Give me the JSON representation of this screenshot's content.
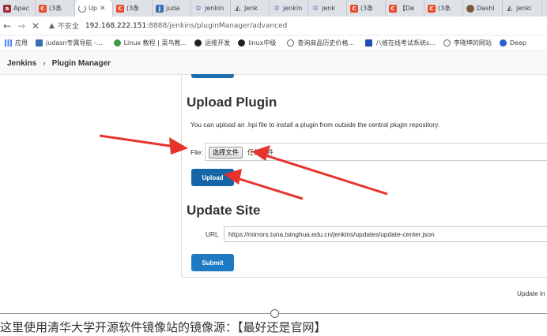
{
  "browser": {
    "tabs": [
      {
        "icon": "apache-icon",
        "label": "Apac",
        "active": false
      },
      {
        "icon": "csdn-icon",
        "label": "(3条",
        "active": false
      },
      {
        "icon": "loading-icon",
        "label": "Up",
        "active": true,
        "close": "✕"
      },
      {
        "icon": "csdn-icon",
        "label": "(3条",
        "active": false
      },
      {
        "icon": "judas-icon",
        "label": "juda",
        "active": false
      },
      {
        "icon": "jenkins-icon",
        "label": "jenkin",
        "active": false
      },
      {
        "icon": "jenkins-icon",
        "label": "Jenk",
        "active": false
      },
      {
        "icon": "jenkins-icon",
        "label": "jenkin",
        "active": false
      },
      {
        "icon": "jenkins-icon",
        "label": "jenk",
        "active": false
      },
      {
        "icon": "csdn-icon",
        "label": "(3条",
        "active": false
      },
      {
        "icon": "csdn-icon",
        "label": "【De",
        "active": false
      },
      {
        "icon": "csdn-icon",
        "label": "(3条",
        "active": false
      },
      {
        "icon": "dashboard-icon",
        "label": "Dashl",
        "active": false
      },
      {
        "icon": "jenkins-icon",
        "label": "jenki",
        "active": false
      }
    ],
    "address": {
      "security_label": "不安全",
      "url_host": "192.168.222.151",
      "url_path": ":8888/jenkins/pluginManager/advanced"
    },
    "bookmarks": [
      {
        "icon": "apps-grid-icon",
        "label": "应用"
      },
      {
        "icon": "judas-icon",
        "label": "judasn专属导航 -..."
      },
      {
        "icon": "linux-icon",
        "label": "Linux 教程 | 菜鸟教..."
      },
      {
        "icon": "ops-icon",
        "label": "运维开发"
      },
      {
        "icon": "linux-mid-icon",
        "label": "linux中级"
      },
      {
        "icon": "globe-icon",
        "label": "查询商品历史价格..."
      },
      {
        "icon": "exam-icon",
        "label": "八维在线考试系统s..."
      },
      {
        "icon": "globe-icon",
        "label": "李晓坤的网站"
      },
      {
        "icon": "deepl-icon",
        "label": "Deep"
      }
    ]
  },
  "jenkins": {
    "breadcrumb": [
      "Jenkins",
      "Plugin Manager"
    ],
    "upload_section": {
      "title": "Upload Plugin",
      "description": "You can upload an .hpi file to install a plugin from outside the central plugin repository.",
      "file_label": "File:",
      "choose_button": "选择文件",
      "no_file_text": "任何文件",
      "upload_button": "Upload"
    },
    "update_site": {
      "title": "Update Site",
      "url_label": "URL",
      "url_value": "https://mirrors.tuna.tsinghua.edu.cn/jenkins/updates/update-center.json",
      "submit_button": "Submit"
    },
    "update_info": "Update in"
  },
  "annotation": {
    "arrow_color": "#e8322c",
    "caption": "这里使用清华大学开源软件镜像站的镜像源：【最好还是官网】"
  }
}
